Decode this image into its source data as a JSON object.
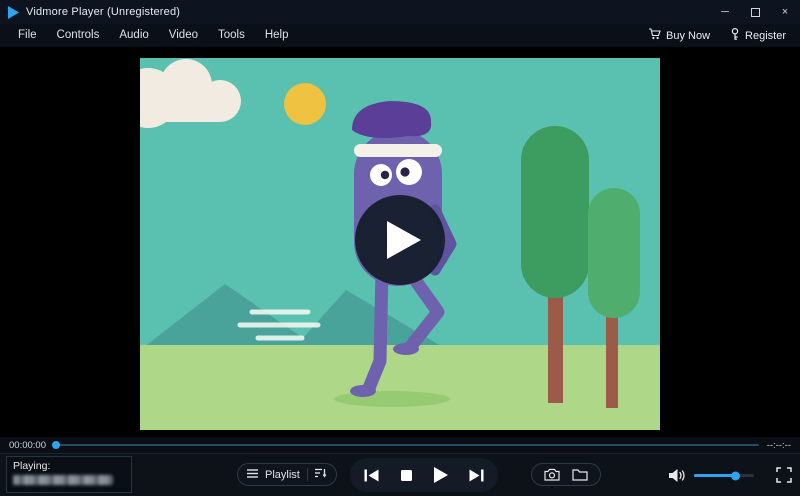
{
  "window": {
    "title": "Vidmore Player (Unregistered)"
  },
  "titlebar": {
    "minimize_glyph": "─",
    "close_glyph": "×"
  },
  "menubar": {
    "items": [
      "File",
      "Controls",
      "Audio",
      "Video",
      "Tools",
      "Help"
    ]
  },
  "actions": {
    "buy_now": "Buy Now",
    "register": "Register"
  },
  "seek": {
    "elapsed": "00:00:00",
    "remaining": "--:--:--"
  },
  "bottom": {
    "playing_label": "Playing:",
    "playlist_label": "Playlist"
  },
  "player_state": {
    "position_percent": 0,
    "volume_percent": 68,
    "status": "stopped"
  },
  "colors": {
    "accent_blue": "#2ea3f2",
    "titlebar_bg": "#0d1420",
    "video_teal": "#5ac0b0",
    "grass_green": "#aed787",
    "tree_green_dark": "#3d9c60",
    "tree_green_light": "#4fae6d",
    "trunk_brown": "#9c5b49",
    "sun_yellow": "#efc241",
    "cloud_cream": "#f2ebe1",
    "mountain_teal": "#4aa39a",
    "character_purple": "#6e61ad",
    "hat_purple": "#5b3e98"
  }
}
